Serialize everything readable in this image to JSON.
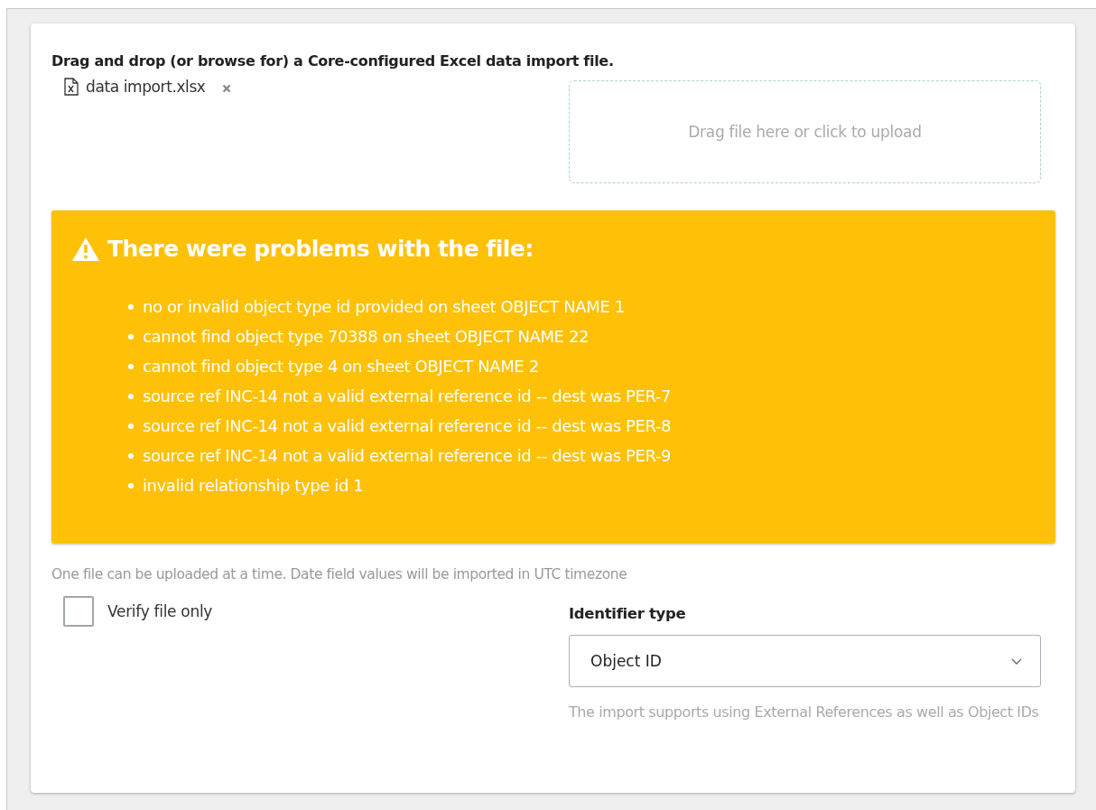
{
  "instructions": "Drag and drop (or browse for) a Core-configured Excel data import file.",
  "file": {
    "name": "data import.xlsx"
  },
  "dropzone": {
    "text": "Drag file here or click to upload"
  },
  "alert": {
    "title": "There were problems with the file:",
    "items": [
      "no or invalid object type id provided on sheet OBJECT NAME 1",
      "cannot find object type 70388 on sheet OBJECT NAME 22",
      "cannot find object type 4 on sheet OBJECT NAME 2",
      "source ref INC-14 not a valid external reference id -- dest was PER-7",
      "source ref INC-14 not a valid external reference id -- dest was PER-8",
      "source ref INC-14 not a valid external reference id -- dest was PER-9",
      "invalid relationship type id 1"
    ]
  },
  "note": "One file can be uploaded at a time. Date field values will be imported in UTC timezone",
  "verify": {
    "label": "Verify file only",
    "checked": false
  },
  "identifier": {
    "label": "Identifier type",
    "value": "Object ID",
    "help": "The import supports using External References as well as Object IDs"
  }
}
